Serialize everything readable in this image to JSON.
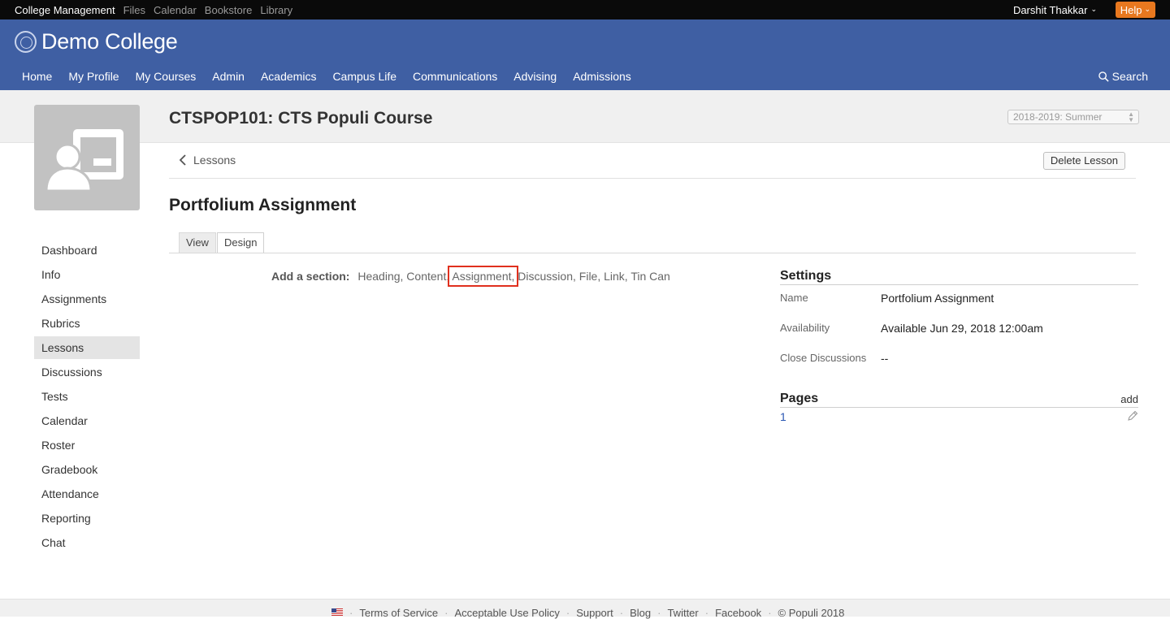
{
  "topbar": {
    "apps": [
      "College Management",
      "Files",
      "Calendar",
      "Bookstore",
      "Library"
    ],
    "user_name": "Darshit Thakkar",
    "help_label": "Help"
  },
  "header": {
    "college_name": "Demo College",
    "nav": [
      "Home",
      "My Profile",
      "My Courses",
      "Admin",
      "Academics",
      "Campus Life",
      "Communications",
      "Advising",
      "Admissions"
    ],
    "search_label": "Search"
  },
  "course": {
    "title": "CTSPOP101: CTS Populi Course",
    "term": "2018-2019: Summer"
  },
  "sidebar": {
    "items": [
      "Dashboard",
      "Info",
      "Assignments",
      "Rubrics",
      "Lessons",
      "Discussions",
      "Tests",
      "Calendar",
      "Roster",
      "Gradebook",
      "Attendance",
      "Reporting",
      "Chat"
    ],
    "active": "Lessons"
  },
  "lesson": {
    "back_label": "Lessons",
    "delete_label": "Delete Lesson",
    "title": "Portfolium Assignment",
    "tabs": {
      "view": "View",
      "design": "Design"
    },
    "add_section_label": "Add a section:",
    "section_options": [
      "Heading,",
      "Content,",
      "Assignment,",
      "Discussion,",
      "File,",
      "Link,",
      "Tin Can"
    ]
  },
  "settings": {
    "heading": "Settings",
    "rows": [
      {
        "key": "Name",
        "value": "Portfolium Assignment"
      },
      {
        "key": "Availability",
        "value": "Available Jun 29, 2018 12:00am"
      },
      {
        "key": "Close Discussions",
        "value": "--"
      }
    ]
  },
  "pages": {
    "heading": "Pages",
    "add_label": "add",
    "items": [
      "1"
    ]
  },
  "footer": {
    "links": [
      "Terms of Service",
      "Acceptable Use Policy",
      "Support",
      "Blog",
      "Twitter",
      "Facebook",
      "© Populi 2018"
    ]
  },
  "colors": {
    "header_blue": "#3f5fa3",
    "help_orange": "#e8781f",
    "highlight_red": "#e0301e",
    "link_blue": "#2a57b3"
  }
}
